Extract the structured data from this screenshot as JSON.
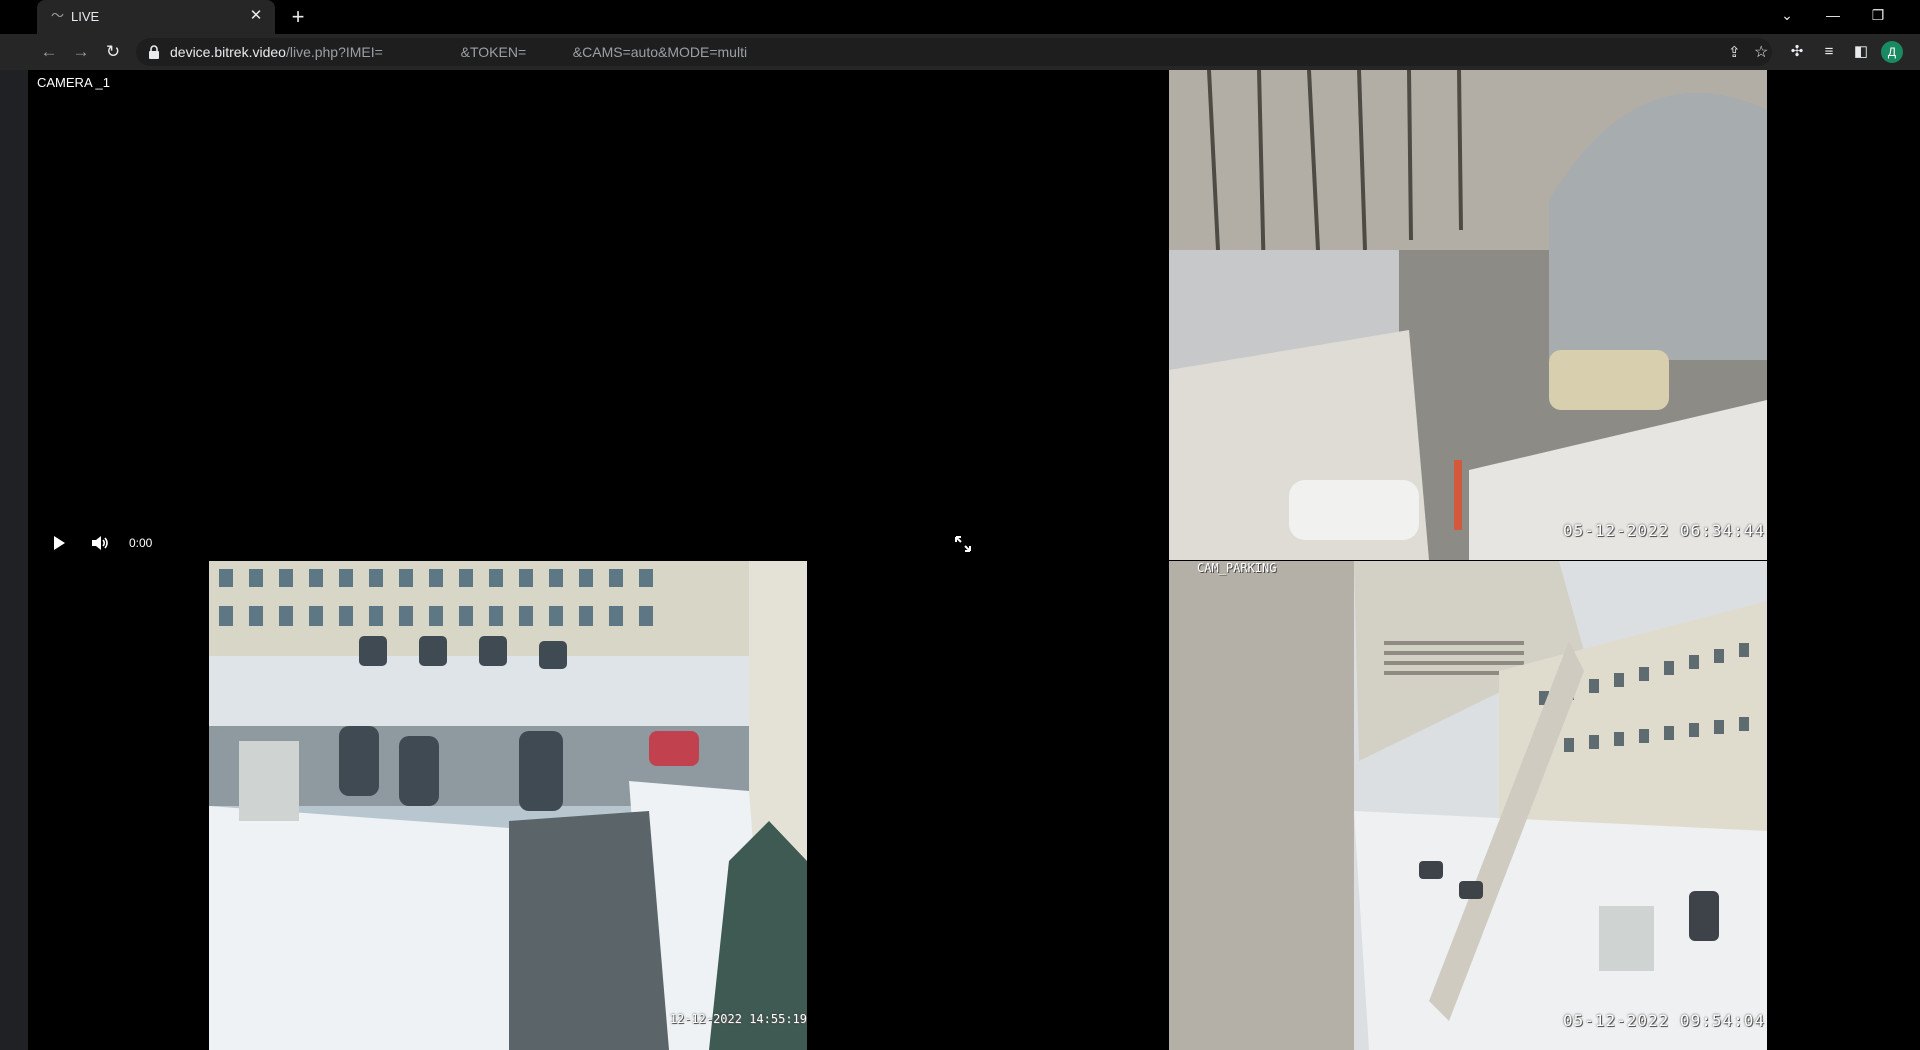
{
  "browser": {
    "tab_title": "LIVE",
    "tab_close": "✕",
    "new_tab": "+",
    "url_host": "device.bitrek.video",
    "url_path": "/live.php?IMEI=                    &TOKEN=            &CAMS=auto&MODE=multi",
    "avatar_letter": "Д",
    "colors": {
      "chrome": "#262626",
      "tabbar": "#000000",
      "avatar": "#1a8a63"
    }
  },
  "player": {
    "camera_label": "CAMERA _1",
    "time": "0:00",
    "icons": [
      "play-icon",
      "volume-icon",
      "fullscreen-icon"
    ]
  },
  "feeds": {
    "bottom_left": {
      "timestamp": "12-12-2022 14:55:19"
    },
    "top_right": {
      "timestamp": "05-12-2022 06:34:44"
    },
    "bottom_right": {
      "camera_name": "CAM_PARKING",
      "timestamp": "05-12-2022 09:54:04"
    }
  }
}
